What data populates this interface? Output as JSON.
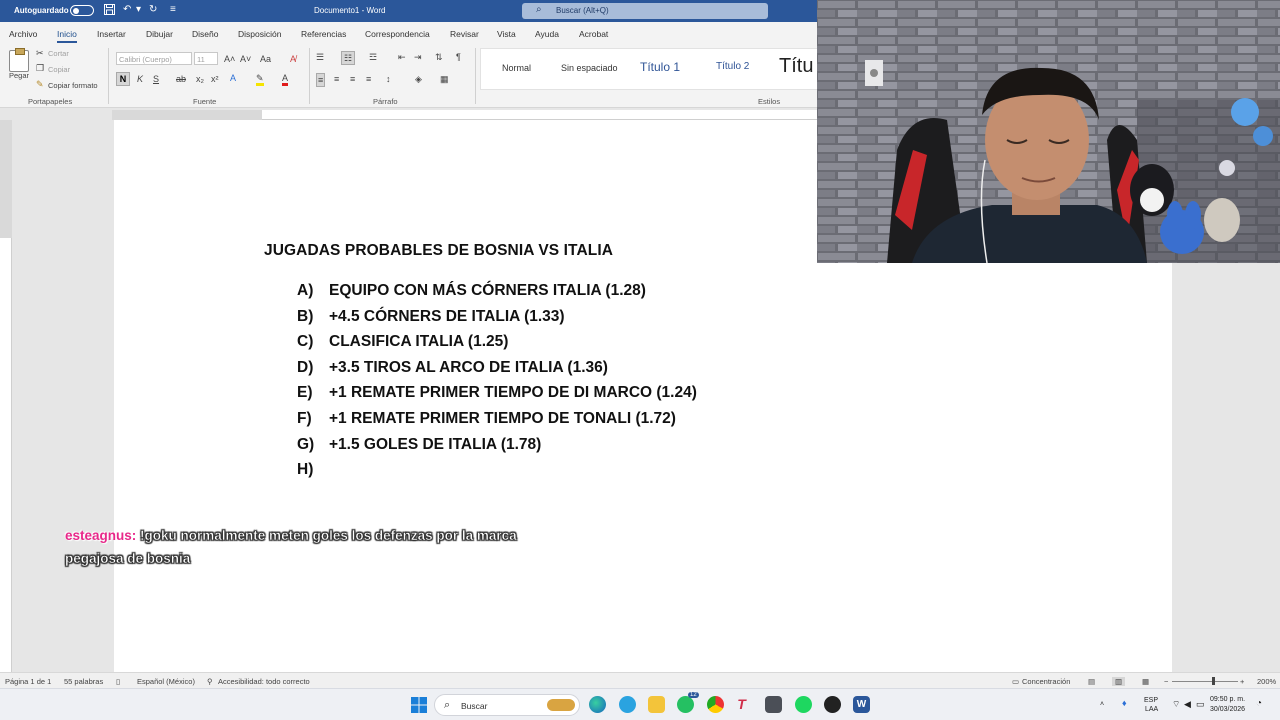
{
  "titlebar": {
    "autosave_label": "Autoguardado",
    "doc_title": "Documento1 - Word",
    "search_placeholder": "Buscar (Alt+Q)"
  },
  "ribbon": {
    "tabs": [
      "Archivo",
      "Inicio",
      "Insertar",
      "Dibujar",
      "Diseño",
      "Disposición",
      "Referencias",
      "Correspondencia",
      "Revisar",
      "Vista",
      "Ayuda",
      "Acrobat"
    ],
    "active_tab": "Inicio",
    "clipboard": {
      "paste": "Pegar",
      "cut": "Cortar",
      "copy": "Copiar",
      "format_painter": "Copiar formato",
      "group": "Portapapeles"
    },
    "font": {
      "name": "Calibri (Cuerpo)",
      "size": "11",
      "group": "Fuente"
    },
    "paragraph": {
      "group": "Párrafo"
    },
    "styles": {
      "items": [
        "Normal",
        "Sin espaciado",
        "Título 1",
        "Título 2",
        "Títu"
      ],
      "group": "Estilos"
    }
  },
  "document": {
    "heading": "JUGADAS PROBABLES DE BOSNIA VS ITALIA",
    "items": [
      {
        "marker": "A)",
        "text": "EQUIPO CON MÁS CÓRNERS ITALIA (1.28)"
      },
      {
        "marker": "B)",
        "text": "+4.5 CÓRNERS DE ITALIA (1.33)"
      },
      {
        "marker": "C)",
        "text": "CLASIFICA ITALIA (1.25)"
      },
      {
        "marker": "D)",
        "text": "+3.5 TIROS AL ARCO DE ITALIA (1.36)"
      },
      {
        "marker": "E)",
        "text": "+1 REMATE PRIMER TIEMPO DE DI MARCO (1.24)"
      },
      {
        "marker": "F)",
        "text": "+1 REMATE PRIMER TIEMPO DE TONALI (1.72)"
      },
      {
        "marker": "G)",
        "text": "+1.5 GOLES DE ITALIA (1.78)"
      },
      {
        "marker": "H)",
        "text": ""
      }
    ]
  },
  "chat": {
    "username": "esteagnus:",
    "message": "!goku normalmente meten goles los defenzas por la marca pegajosa de bosnia"
  },
  "statusbar": {
    "page": "Página 1 de 1",
    "words": "55 palabras",
    "language": "Español (México)",
    "accessibility": "Accesibilidad: todo correcto",
    "focus": "Concentración",
    "zoom": "200%"
  },
  "taskbar": {
    "search_placeholder": "Buscar",
    "whatsapp_badge": "12",
    "lang": "ESP",
    "lang_sub": "LAA",
    "time": "09:50 p. m.",
    "date": "30/03/2026"
  },
  "icons": {
    "save": "save-icon",
    "undo": "undo-icon",
    "redo": "redo-icon",
    "search": "search-icon",
    "windows": "windows-start-icon"
  },
  "colors": {
    "word_blue": "#2b579a",
    "chat_username": "#e8288a"
  }
}
